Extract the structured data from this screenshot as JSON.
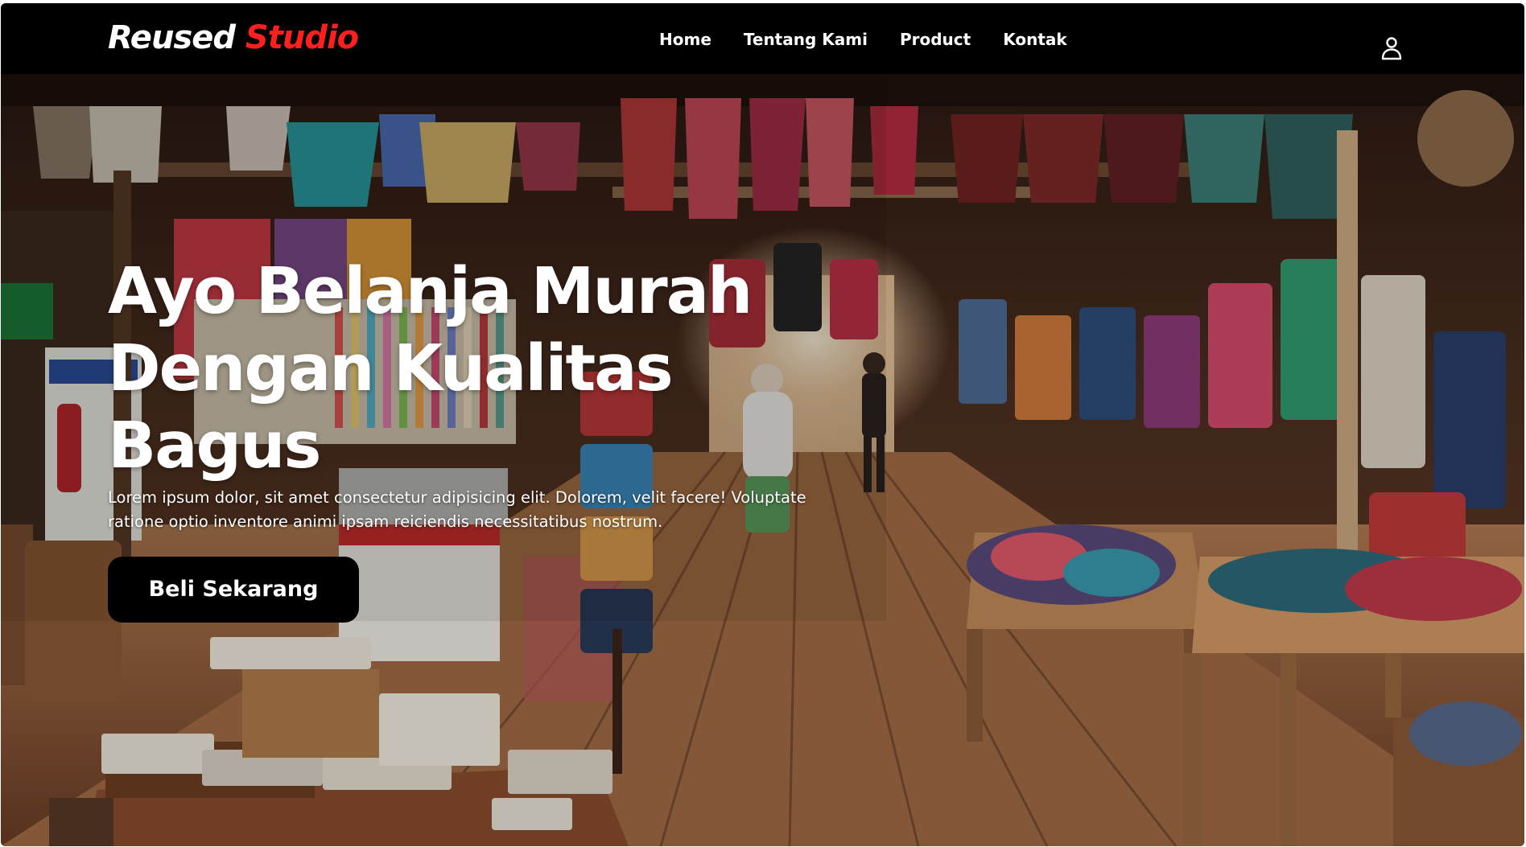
{
  "brand": {
    "name_part1": "Reused",
    "name_part2": "Studio",
    "accent_color": "#ff1f1f"
  },
  "nav": {
    "links": [
      "Home",
      "Tentang Kami",
      "Product",
      "Kontak"
    ],
    "user_icon": "user-icon"
  },
  "hero": {
    "title": "Ayo Belanja Murah Dengan Kualitas Bagus",
    "description": "Lorem ipsum dolor, sit amet consectetur adipisicing elit. Dolorem, velit facere! Voluptate ratione optio inventore animi ipsam reiciendis necessitatibus nostrum.",
    "cta_label": "Beli Sekarang",
    "background_image": "market-stall-photo"
  },
  "colors": {
    "navbar_bg": "#000000",
    "text": "#ffffff",
    "button_bg": "#000000"
  }
}
